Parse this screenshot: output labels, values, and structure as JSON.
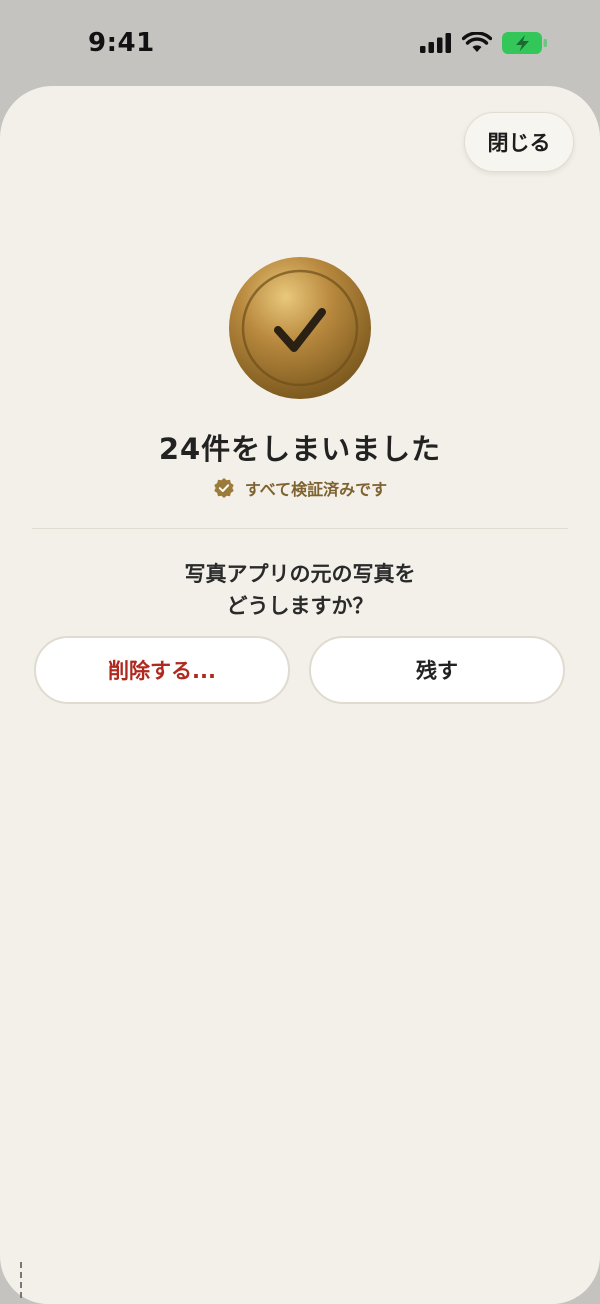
{
  "status_bar": {
    "time": "9:41"
  },
  "close_label": "閉じる",
  "result": {
    "title": "24件をしまいました",
    "verified_text": "すべて検証済みです"
  },
  "prompt": {
    "line1": "写真アプリの元の写真を",
    "line2": "どうしますか？"
  },
  "actions": {
    "delete_label": "削除する...",
    "keep_label": "残す"
  },
  "colors": {
    "accent_gold": "#a67c34",
    "danger": "#b0291f",
    "battery_green": "#33c759"
  },
  "icons": [
    "signal-icon",
    "wifi-icon",
    "battery-charging-icon",
    "check-icon",
    "verified-badge-icon"
  ]
}
